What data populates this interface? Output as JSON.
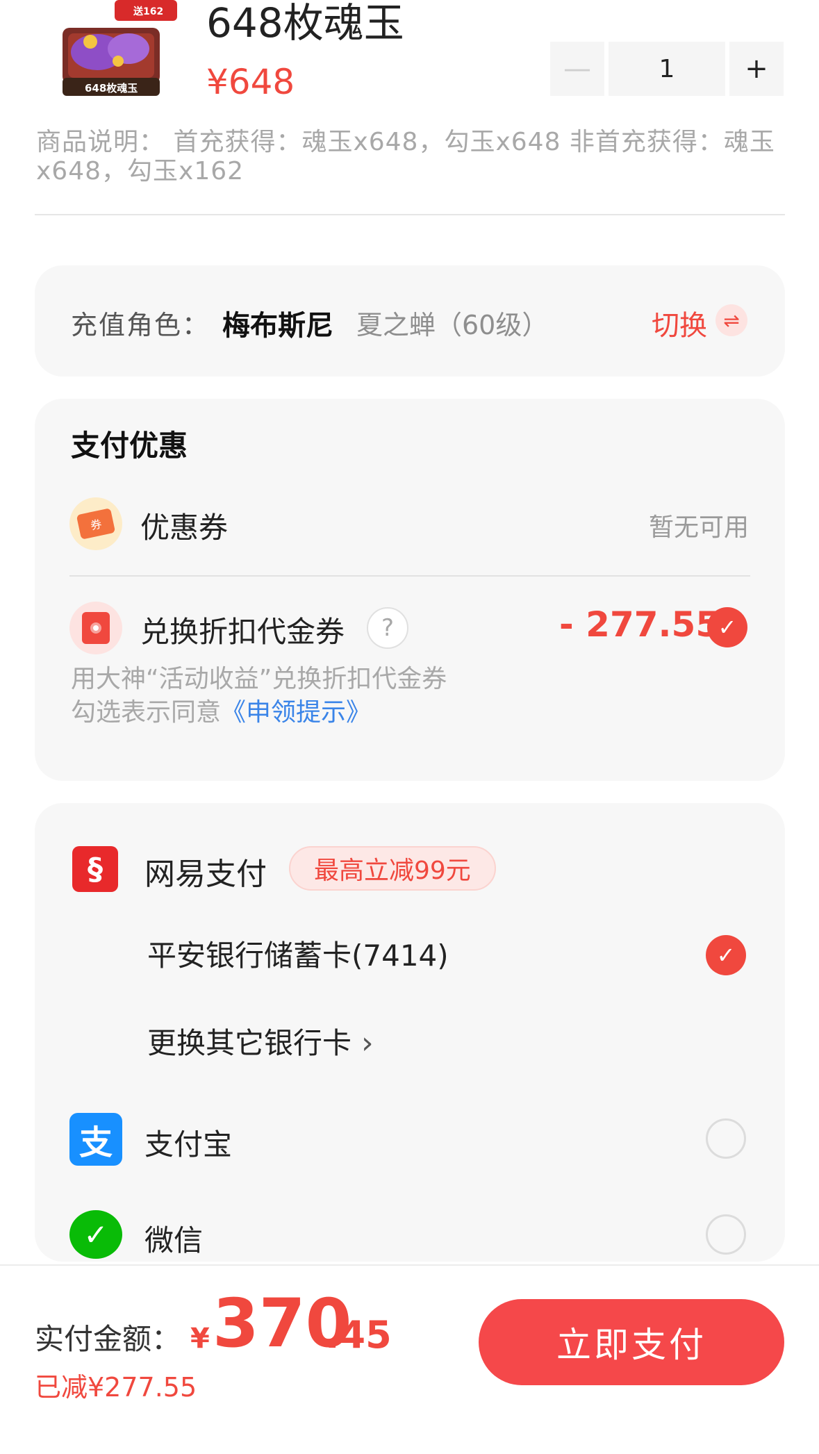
{
  "product": {
    "name": "648枚魂玉",
    "price": "¥648",
    "thumb_badge": "送162",
    "thumb_caption": "648枚魂玉",
    "quantity": "1",
    "minus_symbol": "—",
    "plus_symbol": "+",
    "description": "商品说明：  首充获得：魂玉x648，勾玉x648 非首充获得：魂玉x648，勾玉x162"
  },
  "role": {
    "label": "充值角色：",
    "name": "梅布斯尼",
    "server": "夏之蝉（60级）",
    "switch_label": "切换",
    "switch_icon": "swap-icon"
  },
  "promo": {
    "title": "支付优惠",
    "coupon_label": "优惠券",
    "coupon_status": "暂无可用",
    "coupon_icon_text": "券",
    "redeem_label": "兑换折扣代金券",
    "redeem_help": "?",
    "redeem_amount": "- 277.55",
    "redeem_checked": true,
    "redeem_note_line1": "用大神“活动收益”兑换折扣代金券",
    "redeem_note_prefix": "勾选表示同意",
    "redeem_note_link": "《申领提示》"
  },
  "payment": {
    "netease_label": "网易支付",
    "netease_badge": "最高立减99元",
    "bank_card": "平安银行储蓄卡(7414)",
    "bank_selected": true,
    "change_bank": "更换其它银行卡",
    "alipay_label": "支付宝",
    "alipay_icon_text": "支",
    "wechat_label": "微信",
    "check_symbol": "✓"
  },
  "footer": {
    "paid_label": "实付金额：",
    "currency": "¥",
    "amount_int": "370",
    "amount_dec": ".45",
    "saved": "已减¥277.55",
    "pay_button": "立即支付"
  },
  "colors": {
    "accent": "#f0483e",
    "link": "#3a84e8",
    "alipay": "#1890ff",
    "wechat": "#09bb07"
  }
}
